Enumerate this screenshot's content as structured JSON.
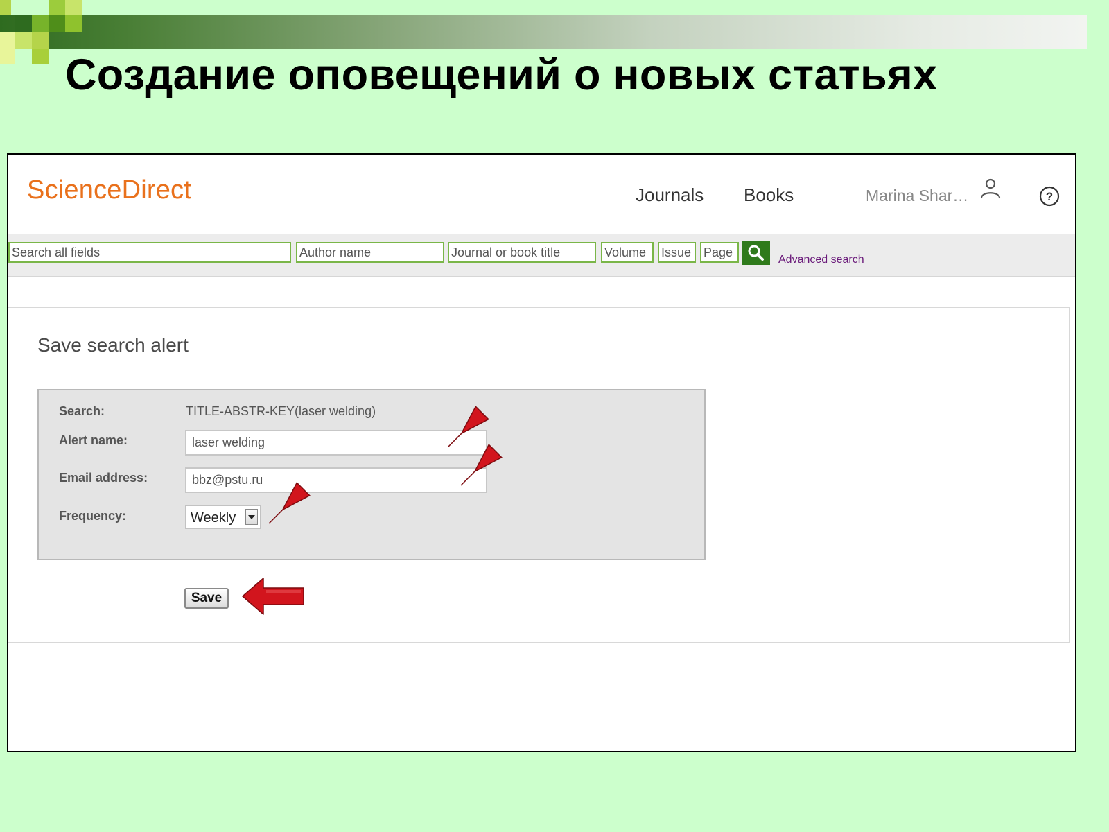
{
  "slide": {
    "title": "Создание оповещений о новых статьях"
  },
  "site": {
    "logo": "ScienceDirect",
    "nav": {
      "journals": "Journals",
      "books": "Books"
    },
    "user_name": "Marina Shar…",
    "user_icon": "person-icon",
    "help_icon": "help-circle-icon"
  },
  "search": {
    "all_fields_placeholder": "Search all fields",
    "author_placeholder": "Author name",
    "journal_placeholder": "Journal or book title",
    "volume_placeholder": "Volume",
    "issue_placeholder": "Issue",
    "page_placeholder": "Page",
    "button_icon": "search-icon",
    "advanced_link": "Advanced search"
  },
  "alert_form": {
    "heading": "Save search alert",
    "search_label": "Search:",
    "search_value": "TITLE-ABSTR-KEY(laser welding)",
    "alert_name_label": "Alert name:",
    "alert_name_value": "laser welding",
    "email_label": "Email address:",
    "email_value": "bbz@pstu.ru",
    "frequency_label": "Frequency:",
    "frequency_value": "Weekly",
    "save_label": "Save"
  },
  "colors": {
    "slide_background": "#ccffcc",
    "logo_orange": "#e9711c",
    "field_border_green": "#7ab648",
    "search_button_green": "#2f7a1b",
    "advanced_link_purple": "#6a1a7a",
    "annotation_arrow_red": "#d2151d"
  }
}
